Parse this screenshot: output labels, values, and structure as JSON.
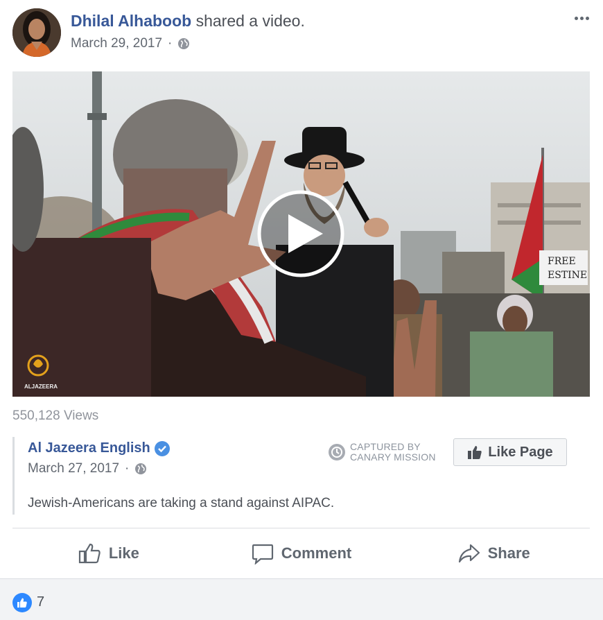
{
  "post": {
    "author": "Dhilal Alhaboob",
    "action_text": " shared a video.",
    "date": "March 29, 2017",
    "date_separator": "·",
    "privacy_icon": "globe-icon",
    "more_icon": "more-icon"
  },
  "video": {
    "views": "550,128 Views",
    "watermark": "ALJAZEERA",
    "banner_text_1": "FREE",
    "banner_text_2": "ESTINE",
    "play_icon": "play-icon"
  },
  "shared_post": {
    "page_name": "Al Jazeera English",
    "verified_icon": "verified-badge-icon",
    "date": "March 27, 2017",
    "date_separator": "·",
    "text": "Jewish-Americans are taking a stand against AIPAC.",
    "captured_line_1": "CAPTURED BY",
    "captured_line_2": "CANARY MISSION",
    "like_page_label": "Like Page"
  },
  "actions": {
    "like_label": "Like",
    "comment_label": "Comment",
    "share_label": "Share"
  },
  "reactions": {
    "count": "7",
    "icon": "like-reaction-icon"
  },
  "colors": {
    "link_blue": "#385898",
    "meta_gray": "#616770",
    "reaction_blue": "#2d88ff",
    "verified_blue": "#4a90e2"
  }
}
